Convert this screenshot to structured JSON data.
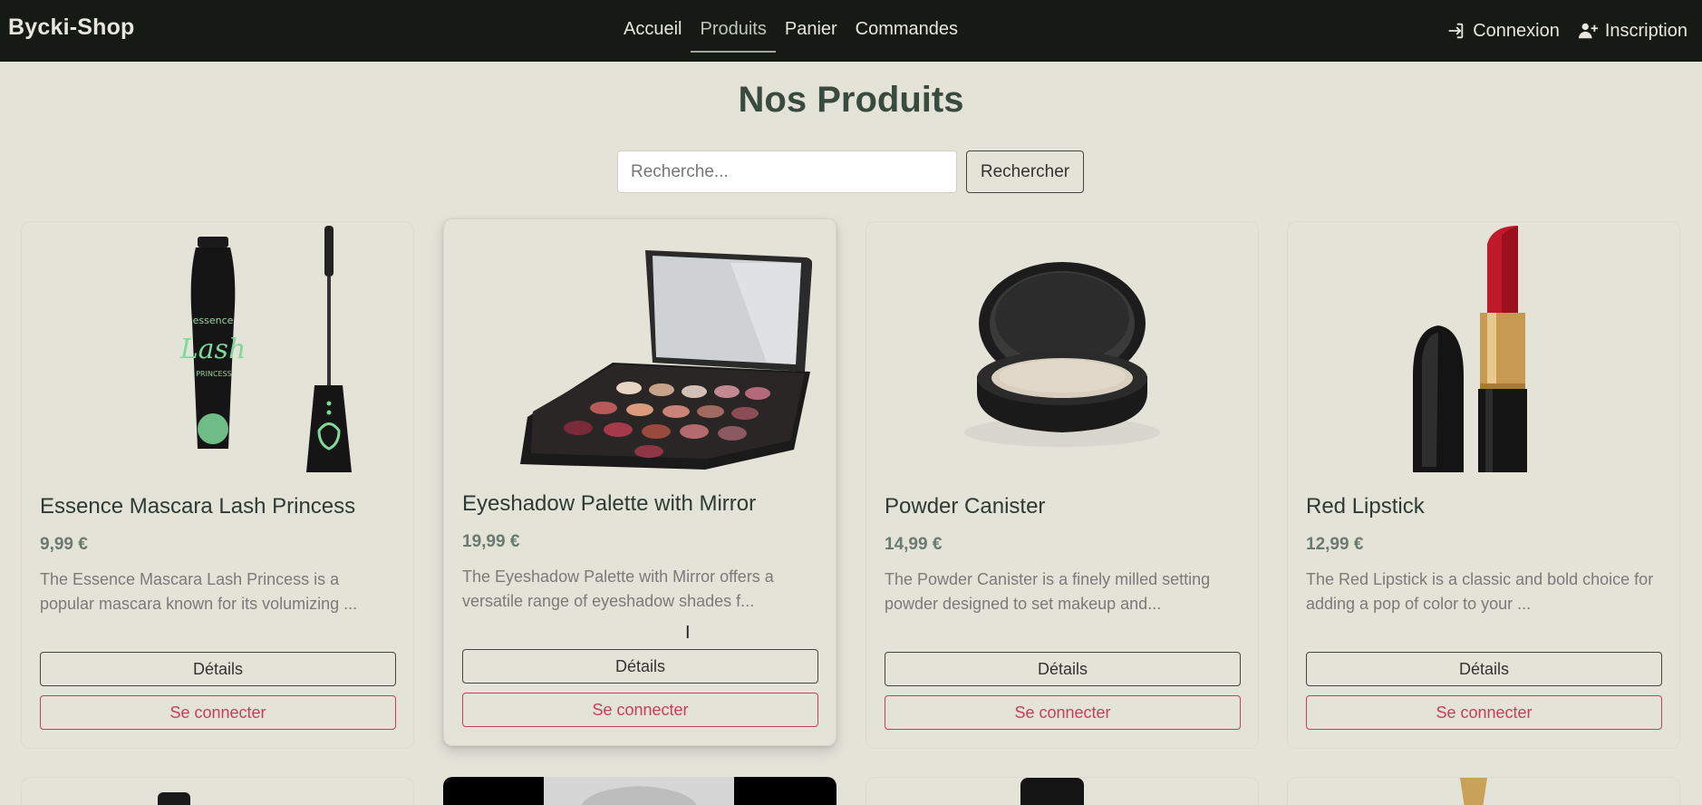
{
  "nav": {
    "brand": "Bycki-Shop",
    "links": [
      {
        "label": "Accueil"
      },
      {
        "label": "Produits"
      },
      {
        "label": "Panier"
      },
      {
        "label": "Commandes"
      }
    ],
    "login": "Connexion",
    "register": "Inscription"
  },
  "page": {
    "title": "Nos Produits"
  },
  "search": {
    "placeholder": "Recherche...",
    "button": "Rechercher"
  },
  "products": [
    {
      "name": "Essence Mascara Lash Princess",
      "price": "9,99 €",
      "description": "The Essence Mascara Lash Princess is a popular mascara known for its volumizing ...",
      "details": "Détails",
      "login": "Se connecter"
    },
    {
      "name": "Eyeshadow Palette with Mirror",
      "price": "19,99 €",
      "description": "The Eyeshadow Palette with Mirror offers a versatile range of eyeshadow shades f...",
      "details": "Détails",
      "login": "Se connecter"
    },
    {
      "name": "Powder Canister",
      "price": "14,99 €",
      "description": "The Powder Canister is a finely milled setting powder designed to set makeup and...",
      "details": "Détails",
      "login": "Se connecter"
    },
    {
      "name": "Red Lipstick",
      "price": "12,99 €",
      "description": "The Red Lipstick is a classic and bold choice for adding a pop of color to your ...",
      "details": "Détails",
      "login": "Se connecter"
    }
  ],
  "icons": {
    "login": "sign-in-icon",
    "register": "user-plus-icon"
  }
}
